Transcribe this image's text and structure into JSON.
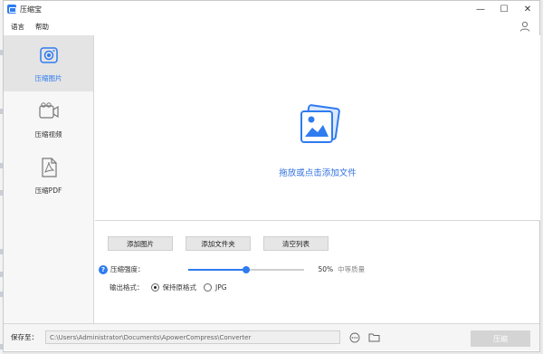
{
  "window": {
    "title": "压缩宝",
    "controls": {
      "minimize": "—",
      "maximize": "☐",
      "close": "✕"
    }
  },
  "menu": {
    "items": [
      "语言",
      "帮助"
    ]
  },
  "sidebar": {
    "items": [
      {
        "label": "压缩图片",
        "icon": "camera-icon",
        "active": true
      },
      {
        "label": "压缩视频",
        "icon": "video-icon",
        "active": false
      },
      {
        "label": "压缩PDF",
        "icon": "pdf-icon",
        "active": false
      }
    ]
  },
  "drop_zone": {
    "text": "拖放或点击添加文件",
    "icon": "image-stack-icon"
  },
  "actions": {
    "add_image": "添加图片",
    "add_folder": "添加文件夹",
    "clear_list": "清空列表"
  },
  "compression": {
    "label": "压缩强度：",
    "value_text": "50%",
    "value": 50,
    "quality_text": "中等质量"
  },
  "output_format": {
    "label": "输出格式：",
    "options": [
      {
        "label": "保持原格式",
        "selected": true
      },
      {
        "label": "JPG",
        "selected": false
      }
    ]
  },
  "save": {
    "label": "保存至：",
    "path": "C:\\Users\\Administrator\\Documents\\ApowerCompress\\Converter"
  },
  "compress_button": "压缩",
  "colors": {
    "accent": "#2f7bf0",
    "disabled_button": "#d4d4d4"
  }
}
